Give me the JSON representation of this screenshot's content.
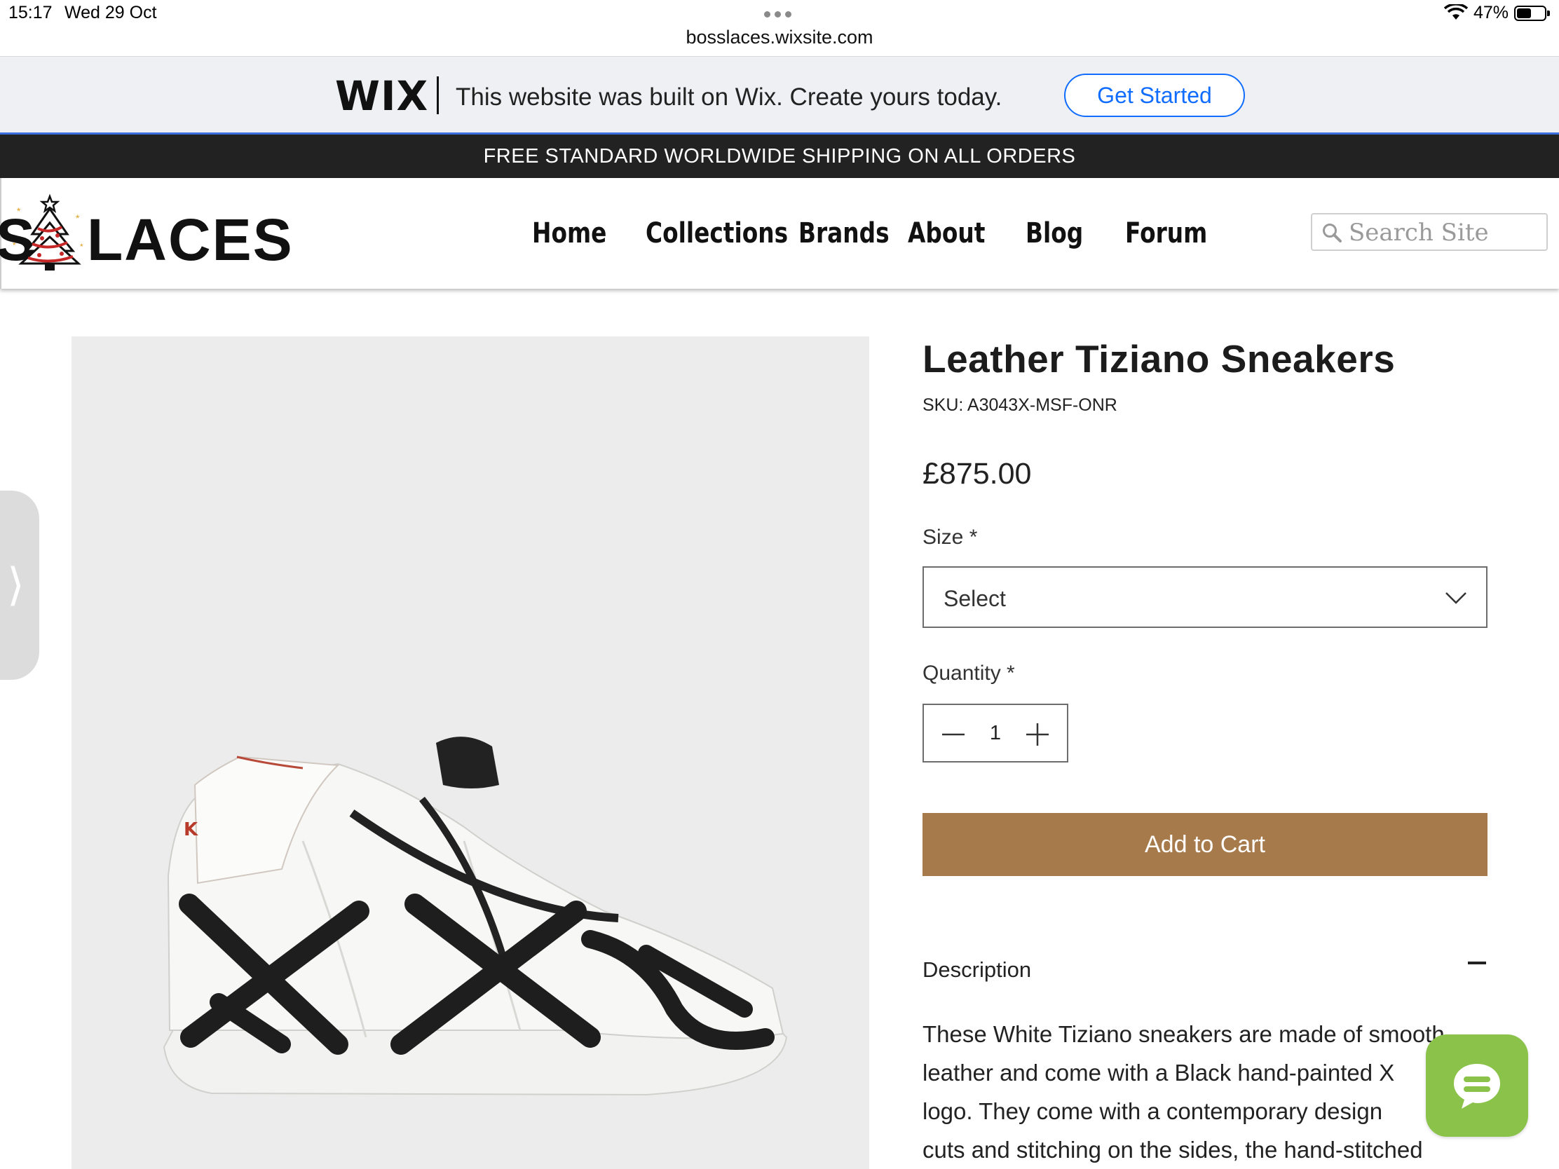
{
  "status_bar": {
    "time": "15:17",
    "date": "Wed 29 Oct",
    "url": "bosslaces.wixsite.com",
    "battery": "47%",
    "battery_level": 0.47
  },
  "wix_banner": {
    "logo": "WIX",
    "message": "This website was built on Wix. Create yours today.",
    "cta": "Get Started"
  },
  "announcement": "FREE STANDARD WORLDWIDE SHIPPING ON ALL ORDERS",
  "header": {
    "logo_partial": "S",
    "logo_text": "LACES",
    "nav": [
      {
        "label": "Home"
      },
      {
        "label": "Collections"
      },
      {
        "label": "Brands"
      },
      {
        "label": "About"
      },
      {
        "label": "Blog"
      },
      {
        "label": "Forum"
      }
    ],
    "search_placeholder": "Search Site"
  },
  "product": {
    "title": "Leather Tiziano Sneakers",
    "sku": "SKU: A3043X-MSF-ONR",
    "price": "£875.00",
    "size_label": "Size *",
    "size_value": "Select",
    "quantity_label": "Quantity *",
    "quantity": "1",
    "add_to_cart": "Add to Cart",
    "description_title": "Description",
    "description_lines": [
      "These White Tiziano sneakers are made of smooth",
      "leather and come with a Black hand-painted X",
      "logo. They come with a contemporary design",
      "cuts and stitching on the sides, the hand-stitched"
    ]
  },
  "colors": {
    "accent_button": "#a67a4a",
    "wix_blue": "#116dff",
    "announcement_bg": "#222222",
    "chat_green": "#8bc34a"
  },
  "icons": {
    "search": "search-icon",
    "chevron": "chevron-down-icon",
    "minus": "minus-icon",
    "plus": "plus-icon",
    "chat": "chat-icon",
    "side_tab": "chevron-right-icon"
  }
}
